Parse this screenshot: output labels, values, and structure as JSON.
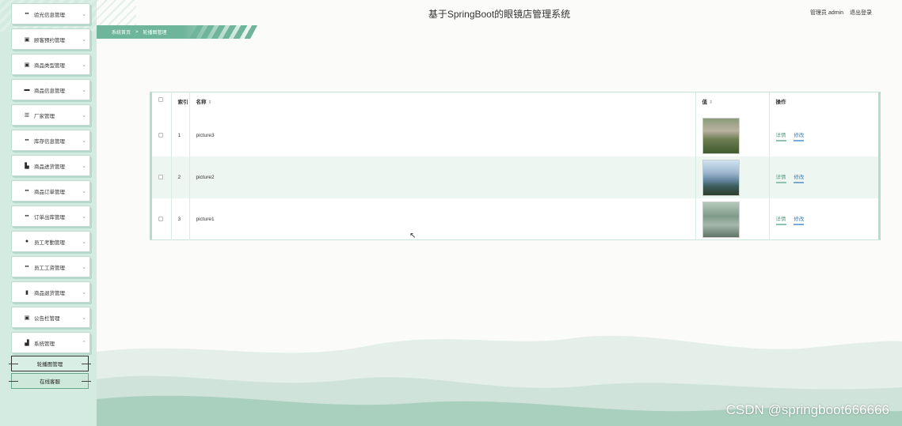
{
  "app": {
    "title": "基于SpringBoot的眼镜店管理系统",
    "user_role": "管理员 admin",
    "logout": "退出登录"
  },
  "breadcrumb": {
    "home": "系统首页",
    "separator": ">",
    "current": "轮播图管理"
  },
  "sidebar": {
    "items": [
      {
        "label": "验光信息管理",
        "icon": "grid-icon"
      },
      {
        "label": "顾客预约管理",
        "icon": "clipboard-icon"
      },
      {
        "label": "商品类型管理",
        "icon": "clipboard-icon"
      },
      {
        "label": "商品信息管理",
        "icon": "monitor-icon"
      },
      {
        "label": "厂家管理",
        "icon": "list-icon"
      },
      {
        "label": "库存信息管理",
        "icon": "grid-icon"
      },
      {
        "label": "商品进货管理",
        "icon": "book-icon"
      },
      {
        "label": "商品订单管理",
        "icon": "grid-icon"
      },
      {
        "label": "订单出库管理",
        "icon": "grid-icon"
      },
      {
        "label": "员工考勤管理",
        "icon": "user-icon"
      },
      {
        "label": "员工工资管理",
        "icon": "grid-icon"
      },
      {
        "label": "商品退货管理",
        "icon": "bar-chart-icon"
      },
      {
        "label": "公告栏管理",
        "icon": "clipboard-icon"
      },
      {
        "label": "系统管理",
        "icon": "chart-icon"
      }
    ],
    "sub_items": [
      {
        "label": "轮播图管理",
        "active": true
      },
      {
        "label": "在线客服",
        "active": false
      }
    ]
  },
  "table": {
    "headers": {
      "index": "索引",
      "name": "名称",
      "value": "值",
      "actions": "操作"
    },
    "rows": [
      {
        "index": "1",
        "name": "picture3"
      },
      {
        "index": "2",
        "name": "picture2"
      },
      {
        "index": "3",
        "name": "picture1"
      }
    ],
    "action_detail": "详情",
    "action_edit": "修改"
  },
  "watermark": "CSDN @springboot666666",
  "colors": {
    "accent": "#6fb59b",
    "sidebar_bg": "#d4ebe1",
    "link_blue": "#3b7fb5"
  }
}
